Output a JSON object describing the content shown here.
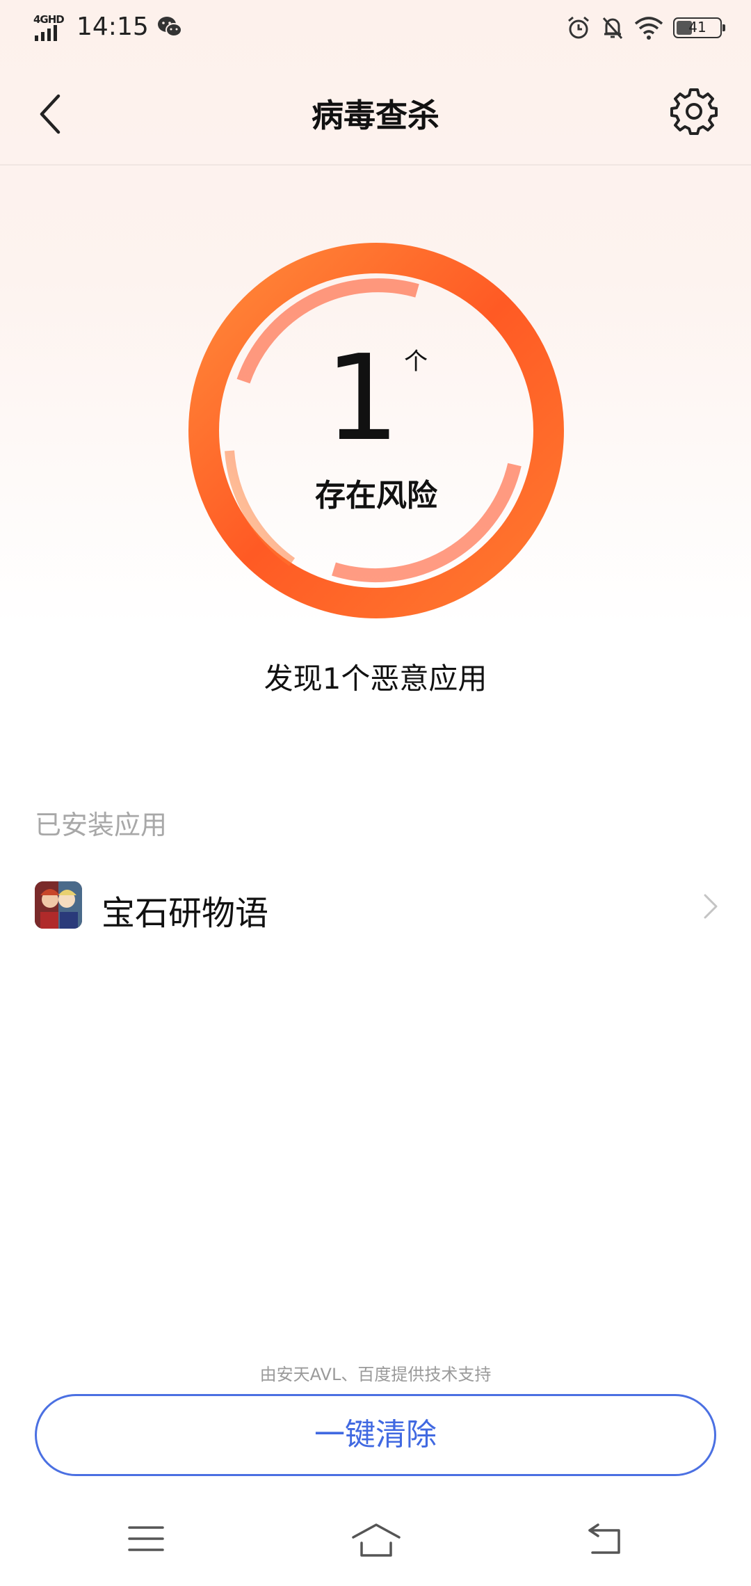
{
  "status_bar": {
    "network": "4GHD",
    "time": "14:15",
    "battery": "41"
  },
  "header": {
    "title": "病毒查杀"
  },
  "result": {
    "count": "1",
    "unit": "个",
    "status": "存在风险",
    "summary": "发现1个恶意应用"
  },
  "installed": {
    "section_label": "已安装应用",
    "items": [
      {
        "name": "宝石研物语"
      }
    ]
  },
  "footer": {
    "powered_by": "由安天AVL、百度提供技术支持",
    "clean_button": "一键清除"
  },
  "colors": {
    "ring_orange": "#ff6a2b",
    "ring_light": "#ff8a3a",
    "button_blue": "#4169e1"
  }
}
